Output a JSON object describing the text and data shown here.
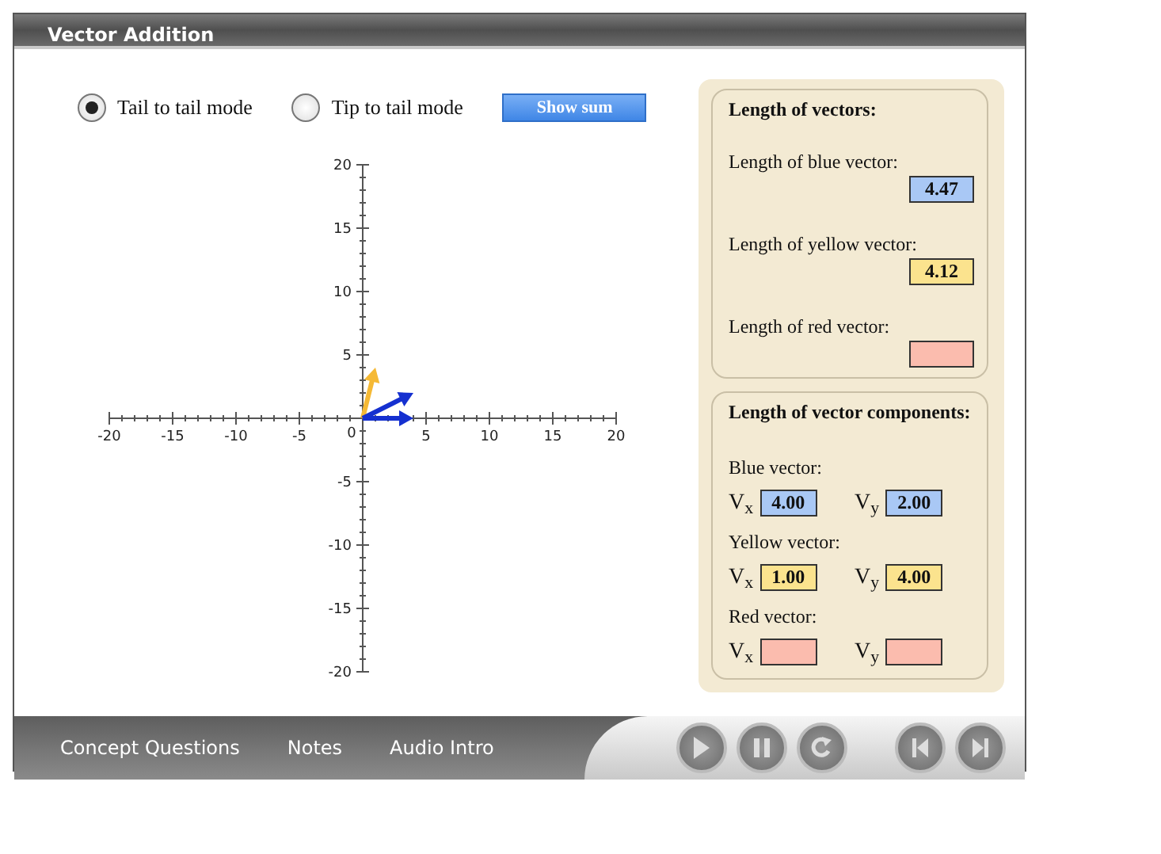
{
  "window": {
    "title": "Vector Addition"
  },
  "modes": [
    {
      "label": "Tail to tail mode",
      "selected": true
    },
    {
      "label": "Tip to tail mode",
      "selected": false
    }
  ],
  "show_sum_button": "Show sum",
  "graph": {
    "x_tick_labels": [
      "-20",
      "-15",
      "-10",
      "-5",
      "0",
      "5",
      "10",
      "15",
      "20"
    ],
    "y_tick_labels": [
      "20",
      "15",
      "10",
      "5",
      "-5",
      "-10",
      "-15",
      "-20"
    ]
  },
  "lengths": {
    "title": "Length of vectors:",
    "items": [
      {
        "label": "Length of blue vector:",
        "value": "4.47",
        "color": "#a9c8f5"
      },
      {
        "label": "Length of yellow vector:",
        "value": "4.12",
        "color": "#fbe38e"
      },
      {
        "label": "Length of red vector:",
        "color": "#fbbcae"
      }
    ]
  },
  "components": {
    "title": "Length of vector components:",
    "items": [
      {
        "label": "Blue vector:",
        "vx_label": "V$_{x}$",
        "vx": "4.00",
        "vy_label": "V$_{y}$",
        "vy": "2.00",
        "color": "#a9c8f5"
      },
      {
        "label": "Yellow vector:",
        "vx_label": "V$_{x}$",
        "vx": "1.00",
        "vy_label": "V$_{y}$",
        "vy": "4.00",
        "color": "#fbe38e"
      },
      {
        "label": "Red vector:",
        "vx_label": "V$_{x}$",
        "vy_label": "V$_{y}$",
        "color": "#fbbcae"
      }
    ]
  },
  "bottom_tabs": [
    "Concept Questions",
    "Notes",
    "Audio Intro"
  ],
  "player_buttons": [
    {
      "kind": "play"
    },
    {
      "kind": "pause"
    },
    {
      "kind": "replay"
    },
    {
      "kind": "previous"
    },
    {
      "kind": "next"
    }
  ]
}
